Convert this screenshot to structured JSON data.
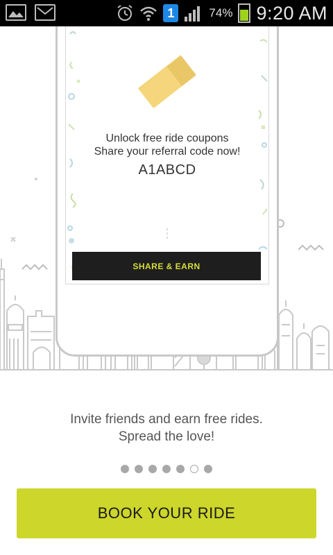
{
  "status_bar": {
    "notification_icons": [
      "gallery-icon",
      "message-icon"
    ],
    "badge_text": "1",
    "battery_percent": "74%",
    "battery_level": 0.74,
    "time": "9:20 AM"
  },
  "card": {
    "line1": "Unlock free ride coupons",
    "line2": "Share your referral code now!",
    "referral_code": "A1ABCD",
    "share_button_label": "SHARE & EARN"
  },
  "tagline": {
    "line1": "Invite friends and earn free rides.",
    "line2": "Spread the love!"
  },
  "pager": {
    "total": 7,
    "active_index": 5
  },
  "cta": {
    "label": "BOOK YOUR RIDE"
  },
  "colors": {
    "accent": "#cdd62a",
    "button_dark": "#1e1e1e",
    "share_text": "#d6de3a",
    "ticket": "#f5d67c"
  }
}
